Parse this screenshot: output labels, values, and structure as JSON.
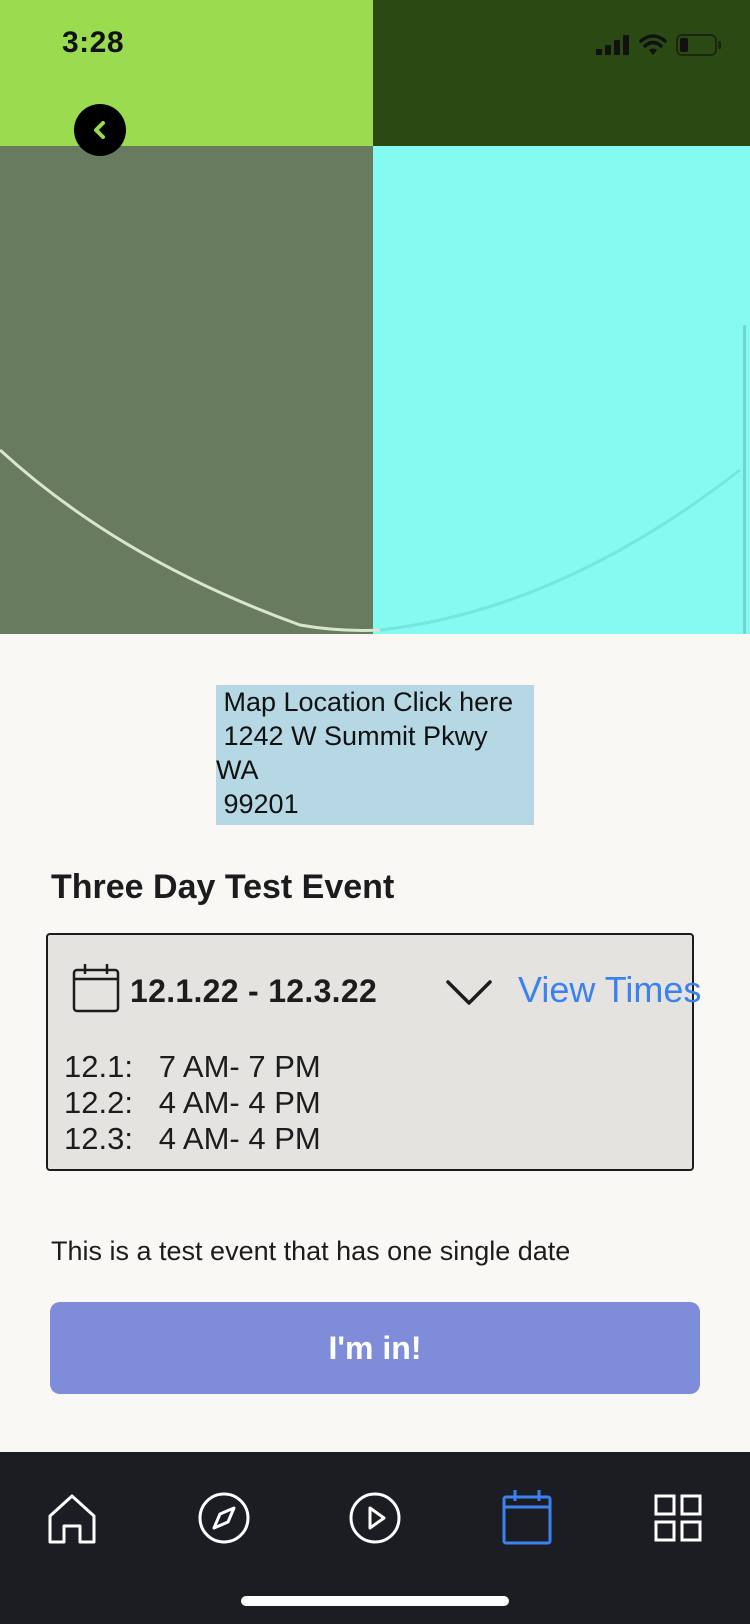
{
  "status_bar": {
    "time": "3:28"
  },
  "map": {
    "colors": {
      "top_left": "#9BDB4F",
      "top_right": "#2B4A13",
      "bottom_left": "#687B5E",
      "bottom_right": "#84FAF1"
    }
  },
  "location": {
    "line1": " Map Location Click here",
    "line2": " 1242 W Summit Pkwy",
    "line3": "WA",
    "line4": " 99201"
  },
  "event": {
    "title": "Three Day Test Event",
    "date_range": "12.1.22 - 12.3.22",
    "view_times_label": "View Times",
    "times": [
      "12.1:   7 AM- 7 PM",
      "12.2:   4 AM- 4 PM",
      "12.3:   4 AM- 4 PM"
    ],
    "description": "This is a test event that has one single date",
    "cta_label": "I'm in!"
  },
  "tab_bar": {
    "active": "calendar",
    "active_color": "#3B82F0",
    "items": [
      "home-icon",
      "compass-icon",
      "play-icon",
      "calendar-icon",
      "grid-icon"
    ]
  }
}
